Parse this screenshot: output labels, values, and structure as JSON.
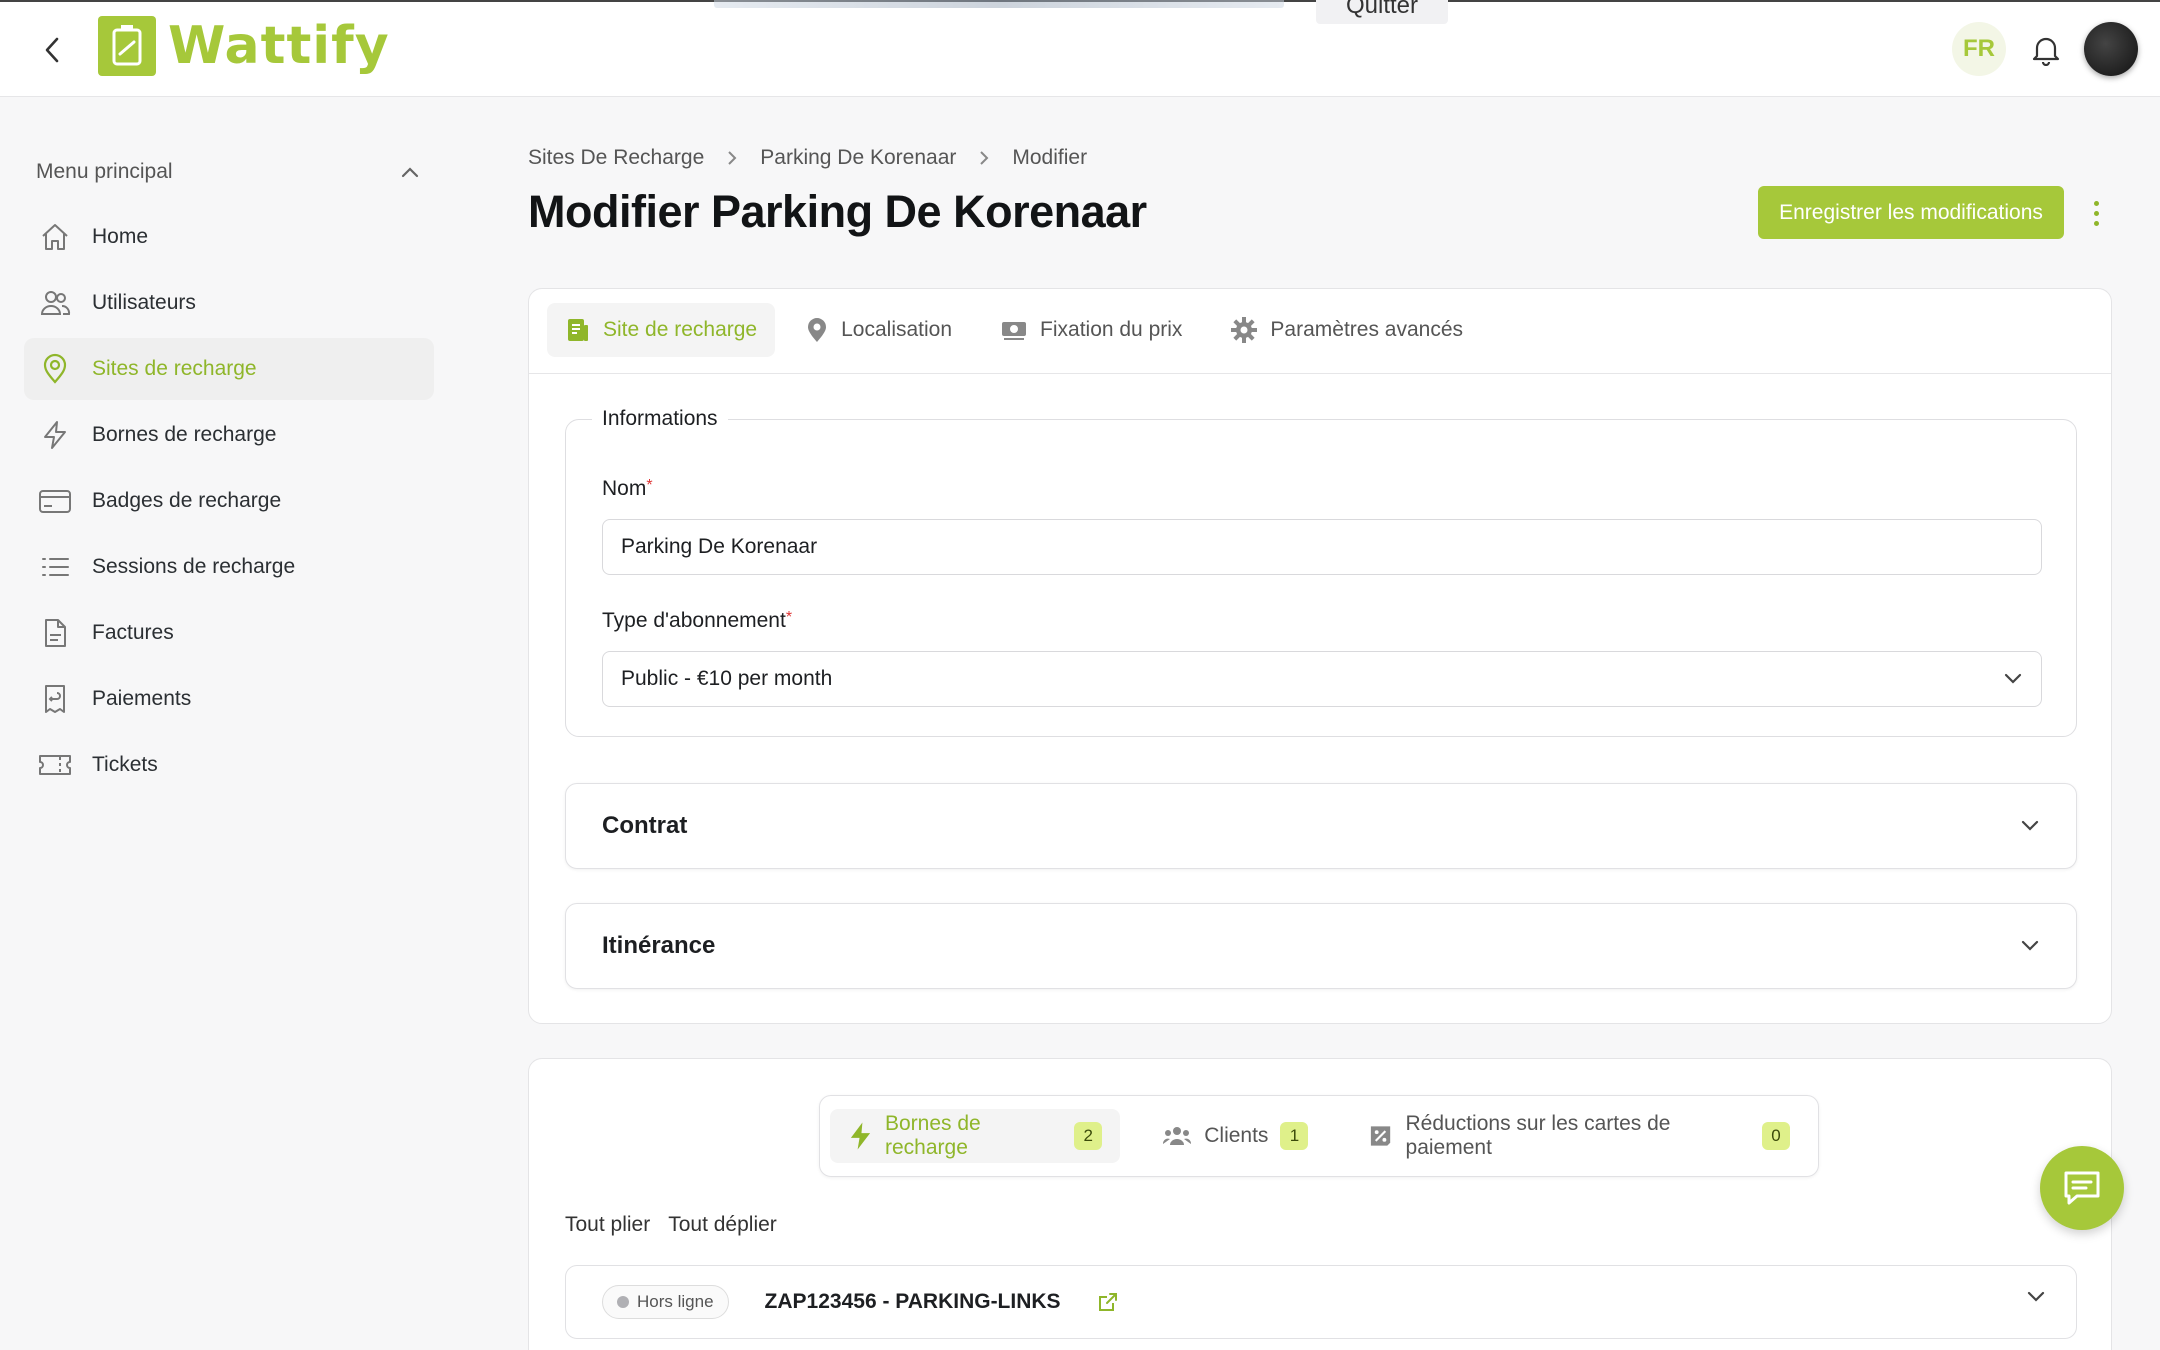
{
  "topbar": {
    "brand": "Wattify",
    "quit_label": "Quitter",
    "language": "FR"
  },
  "sidebar": {
    "menu_title": "Menu principal",
    "items": [
      {
        "label": "Home",
        "icon": "home-icon"
      },
      {
        "label": "Utilisateurs",
        "icon": "users-icon"
      },
      {
        "label": "Sites de recharge",
        "icon": "map-pin-icon",
        "active": true
      },
      {
        "label": "Bornes de recharge",
        "icon": "bolt-icon"
      },
      {
        "label": "Badges de recharge",
        "icon": "card-icon"
      },
      {
        "label": "Sessions de recharge",
        "icon": "list-icon"
      },
      {
        "label": "Factures",
        "icon": "document-icon"
      },
      {
        "label": "Paiements",
        "icon": "receipt-icon"
      },
      {
        "label": "Tickets",
        "icon": "ticket-icon"
      }
    ]
  },
  "breadcrumb": [
    "Sites De Recharge",
    "Parking De Korenaar",
    "Modifier"
  ],
  "page": {
    "title": "Modifier Parking De Korenaar",
    "save_label": "Enregistrer les modifications"
  },
  "tabs": [
    {
      "label": "Site de recharge",
      "icon": "document-icon",
      "active": true
    },
    {
      "label": "Localisation",
      "icon": "map-pin-icon"
    },
    {
      "label": "Fixation du prix",
      "icon": "money-icon"
    },
    {
      "label": "Paramètres avancés",
      "icon": "gear-icon"
    }
  ],
  "form": {
    "legend": "Informations",
    "name_label": "Nom",
    "name_value": "Parking De Korenaar",
    "subscription_label": "Type d'abonnement",
    "subscription_value": "Public - €10 per month",
    "required_mark": "*"
  },
  "accordions": [
    {
      "label": "Contrat"
    },
    {
      "label": "Itinérance"
    }
  ],
  "sub_tabs": [
    {
      "label": "Bornes de recharge",
      "count": "2",
      "icon": "bolt-icon",
      "active": true
    },
    {
      "label": "Clients",
      "count": "1",
      "icon": "users-icon"
    },
    {
      "label": "Réductions sur les cartes de paiement",
      "count": "0",
      "icon": "discount-icon"
    }
  ],
  "fold": {
    "collapse_all": "Tout plier",
    "expand_all": "Tout déplier"
  },
  "station": {
    "status": "Hors ligne",
    "name": "ZAP123456 - PARKING-LINKS"
  },
  "colors": {
    "accent": "#a6c83a",
    "accent_text": "#8fb62a",
    "badge": "#dff08a"
  }
}
